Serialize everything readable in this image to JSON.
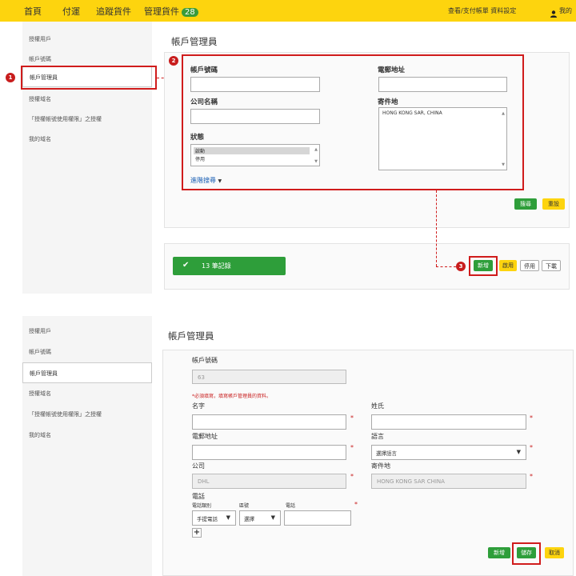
{
  "topnav": {
    "items": [
      "首頁",
      "付運",
      "追蹤貨件",
      "管理貨件"
    ],
    "badge": "28",
    "right_links": "查看/支付帳單  資料設定",
    "user_label": "我的"
  },
  "sidebar": {
    "items": [
      "授權用戶",
      "帳戶號碼",
      "帳戶管理員",
      "授權域名",
      "「授權帳號使用權限」之授權",
      "我的域名"
    ]
  },
  "markers": [
    "1",
    "2",
    "3"
  ],
  "search_panel": {
    "title": "帳戶管理員",
    "account_label": "帳戶號碼",
    "email_label": "電郵地址",
    "company_label": "公司名稱",
    "ship_from_label": "寄件地",
    "ship_from_value": "HONG KONG SAR, CHINA",
    "status_label": "狀態",
    "status_options": [
      "啟動",
      "停用"
    ],
    "advanced_search": "進階搜尋",
    "search_button": "搜尋",
    "reset_button": "重設"
  },
  "results": {
    "record_count": "13 筆記錄",
    "new_button": "新增",
    "enable_button": "啟用",
    "disable_button": "停用",
    "download_button": "下載"
  },
  "form": {
    "title": "帳戶管理員",
    "account_label": "帳戶號碼",
    "account_value": "63",
    "required_note": "*必須填寫，填寫帳戶管理員的資料。",
    "first_name_label": "名字",
    "last_name_label": "姓氏",
    "email_label": "電郵地址",
    "language_label": "語言",
    "language_placeholder": "選擇語言",
    "company_label": "公司",
    "company_value": "DHL",
    "ship_from_label": "寄件地",
    "ship_from_value": "HONG KONG SAR CHINA",
    "phone_label": "電話",
    "phone_type_label": "電話類別",
    "area_code_label": "區號",
    "phone_number_label": "電話",
    "phone_type_value": "手提電話",
    "area_code_value": "選擇",
    "add_phone": "+",
    "new_button": "新增",
    "save_button": "儲存",
    "cancel_button": "取消"
  },
  "colors": {
    "brand_yellow": "#fdd40e",
    "green": "#2e9e3a",
    "highlight_red": "#d01c1c"
  }
}
